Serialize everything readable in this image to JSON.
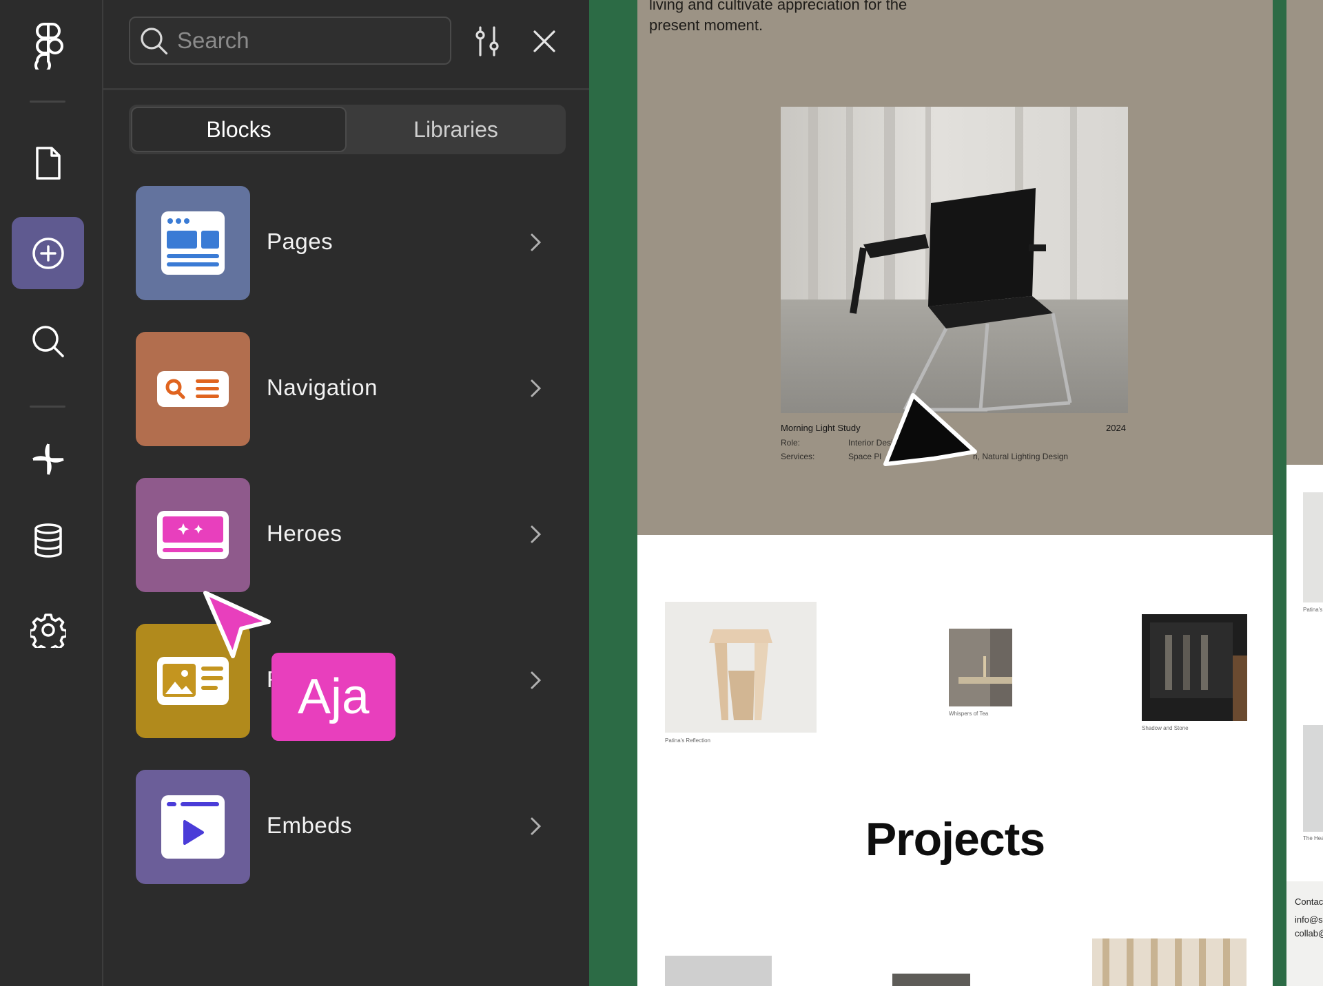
{
  "rail": {
    "items": [
      {
        "name": "figma-logo-icon"
      },
      {
        "name": "page-icon"
      },
      {
        "name": "insert-icon",
        "active": true
      },
      {
        "name": "search-icon"
      },
      {
        "name": "interactions-icon"
      },
      {
        "name": "database-icon"
      },
      {
        "name": "settings-gear-icon"
      }
    ],
    "active_color": "#5f5a90"
  },
  "panel": {
    "search": {
      "placeholder": "Search",
      "value": ""
    },
    "tabs": [
      {
        "label": "Blocks",
        "selected": true
      },
      {
        "label": "Libraries",
        "selected": false
      }
    ],
    "blocks": [
      {
        "label": "Pages",
        "icon": "pages-icon",
        "color": "#63739e"
      },
      {
        "label": "Navigation",
        "icon": "navigation-icon",
        "color": "#b26e4e"
      },
      {
        "label": "Heroes",
        "icon": "heroes-icon",
        "color": "#8f5a8c"
      },
      {
        "label": "F",
        "icon": "features-icon",
        "color": "#b18a1c"
      },
      {
        "label": "Embeds",
        "icon": "embeds-icon",
        "color": "#6b5e99"
      }
    ]
  },
  "collaborator": {
    "name_tag": "Aja",
    "color": "#e83fbd"
  },
  "preview": {
    "intro_text": "living and cultivate appreciation for the present moment.",
    "caption": {
      "title": "Morning Light Study",
      "year": "2024",
      "role_label": "Role:",
      "role_value": "Interior Desig",
      "services_label": "Services:",
      "services_value": "Space Pl",
      "services_tail": "n, Natural Lighting Design"
    },
    "thumbnails": [
      {
        "caption": "Patina's Reflection"
      },
      {
        "caption": "Whispers of Tea"
      },
      {
        "caption": "Shadow and Stone"
      }
    ],
    "section_title": "Projects",
    "next_frame": {
      "thumb_caption_1": "Patina's",
      "thumb_caption_2": "The Hea",
      "footer_contact": "Contac",
      "footer_email_1": "info@s",
      "footer_email_2": "collab@"
    }
  }
}
